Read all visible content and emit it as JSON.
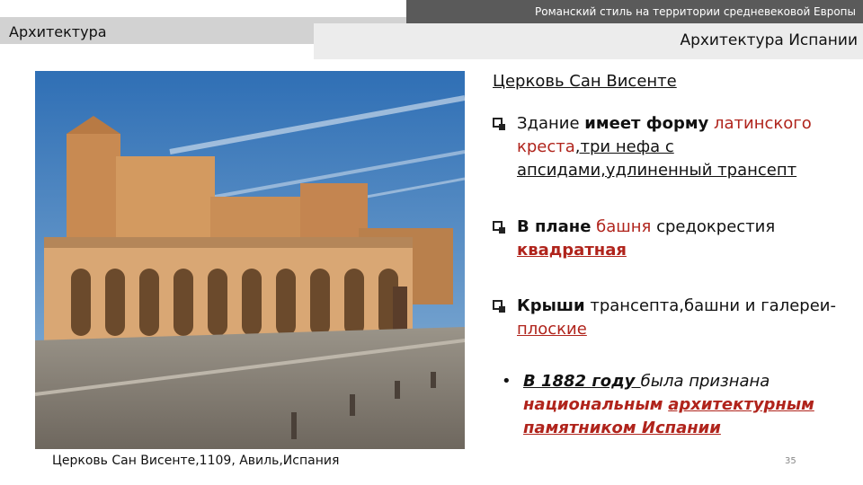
{
  "header": {
    "top_right": "Романский стиль на территории средневековой Европы",
    "left_section": "Архитектура",
    "right_section": "Архитектура Испании"
  },
  "image": {
    "caption": "Церковь Сан Висенте,1109, Авиль,Испания"
  },
  "content": {
    "heading": "Церковь Сан Висенте",
    "item1": {
      "p1": "Здание ",
      "p2": "имеет форму",
      "p3": " ",
      "p4": "латинского",
      "p5": "креста",
      "p6": ",три нефа с",
      "p7": "апсидами,удлиненный трансепт"
    },
    "item2": {
      "p1": "В плане",
      "p2": " ",
      "p3": "башня",
      "p4": " средокрестия",
      "p5": "квадратная"
    },
    "item3": {
      "p1": "Крыши",
      "p2": " трансепта,башни и галереи-",
      "p3": "плоские"
    },
    "item4": {
      "bullet": "•",
      "p1": "В 1882 году ",
      "p2": "была признана",
      "p3": "национальным",
      "p4": " ",
      "p5": "архитектурным",
      "p6": "памятником Испании"
    }
  },
  "footer": {
    "page_number": "35"
  },
  "colors": {
    "accent_red": "#b0241c",
    "header_dark": "#5a5a5a",
    "tab_gray": "#d2d2d2",
    "band_gray": "#ececec"
  }
}
